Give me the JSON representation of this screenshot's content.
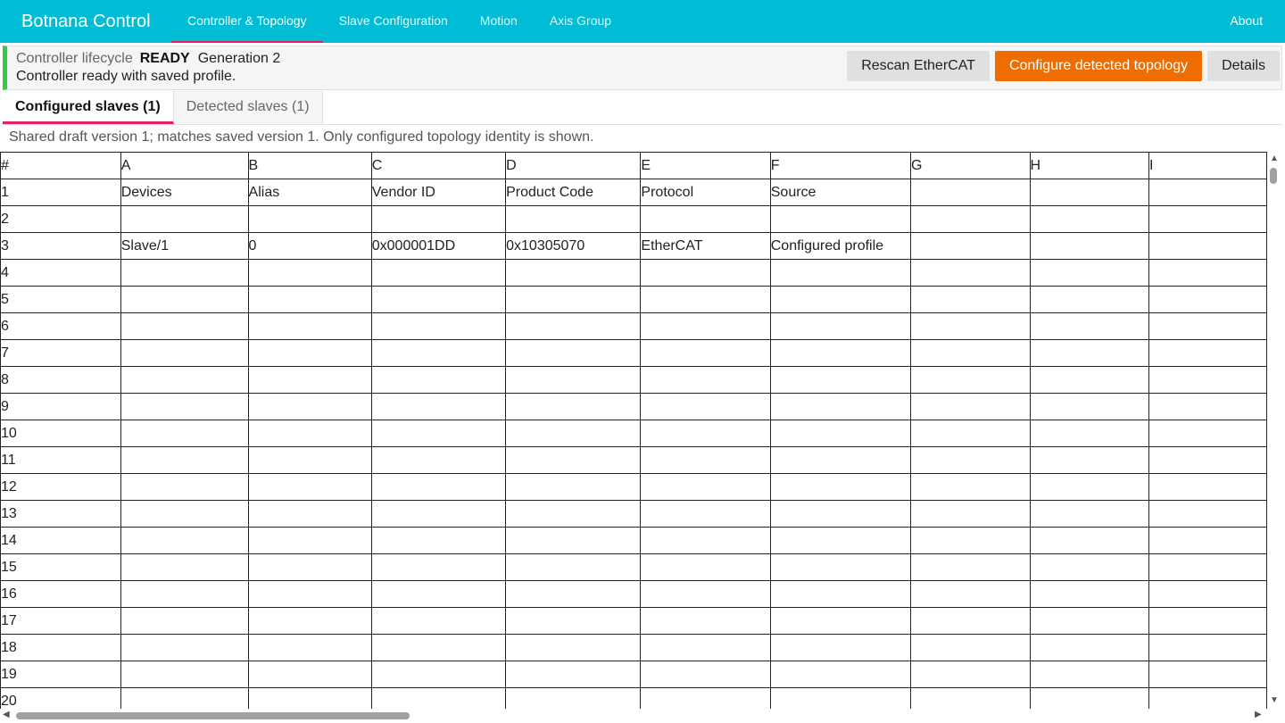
{
  "app": {
    "title": "Botnana Control"
  },
  "nav": {
    "tabs": [
      {
        "label": "Controller & Topology",
        "active": true
      },
      {
        "label": "Slave Configuration",
        "active": false
      },
      {
        "label": "Motion",
        "active": false
      },
      {
        "label": "Axis Group",
        "active": false
      }
    ],
    "about_label": "About"
  },
  "lifecycle": {
    "label": "Controller lifecycle",
    "state": "READY",
    "generation": "Generation 2",
    "message": "Controller ready with saved profile.",
    "status_color": "#2ecc40",
    "actions": {
      "rescan_label": "Rescan EtherCAT",
      "configure_label": "Configure detected topology",
      "details_label": "Details"
    }
  },
  "subtabs": [
    {
      "label": "Configured slaves (1)",
      "active": true
    },
    {
      "label": "Detected slaves (1)",
      "active": false
    }
  ],
  "draft_note": "Shared draft version 1; matches saved version 1. Only configured topology identity is shown.",
  "sheet": {
    "corner": "#",
    "columns": [
      "A",
      "B",
      "C",
      "D",
      "E",
      "F",
      "G",
      "H",
      "I"
    ],
    "rows": [
      {
        "num": "1",
        "cells": [
          "Devices",
          "Alias",
          "Vendor ID",
          "Product Code",
          "Protocol",
          "Source",
          "",
          "",
          ""
        ]
      },
      {
        "num": "2",
        "cells": [
          "",
          "",
          "",
          "",
          "",
          "",
          "",
          "",
          ""
        ]
      },
      {
        "num": "3",
        "cells": [
          "Slave/1",
          "0",
          "0x000001DD",
          "0x10305070",
          "EtherCAT",
          "Configured profile",
          "",
          "",
          ""
        ]
      },
      {
        "num": "4",
        "cells": [
          "",
          "",
          "",
          "",
          "",
          "",
          "",
          "",
          ""
        ]
      },
      {
        "num": "5",
        "cells": [
          "",
          "",
          "",
          "",
          "",
          "",
          "",
          "",
          ""
        ]
      },
      {
        "num": "6",
        "cells": [
          "",
          "",
          "",
          "",
          "",
          "",
          "",
          "",
          ""
        ]
      },
      {
        "num": "7",
        "cells": [
          "",
          "",
          "",
          "",
          "",
          "",
          "",
          "",
          ""
        ]
      },
      {
        "num": "8",
        "cells": [
          "",
          "",
          "",
          "",
          "",
          "",
          "",
          "",
          ""
        ]
      },
      {
        "num": "9",
        "cells": [
          "",
          "",
          "",
          "",
          "",
          "",
          "",
          "",
          ""
        ]
      },
      {
        "num": "10",
        "cells": [
          "",
          "",
          "",
          "",
          "",
          "",
          "",
          "",
          ""
        ]
      },
      {
        "num": "11",
        "cells": [
          "",
          "",
          "",
          "",
          "",
          "",
          "",
          "",
          ""
        ]
      },
      {
        "num": "12",
        "cells": [
          "",
          "",
          "",
          "",
          "",
          "",
          "",
          "",
          ""
        ]
      },
      {
        "num": "13",
        "cells": [
          "",
          "",
          "",
          "",
          "",
          "",
          "",
          "",
          ""
        ]
      },
      {
        "num": "14",
        "cells": [
          "",
          "",
          "",
          "",
          "",
          "",
          "",
          "",
          ""
        ]
      },
      {
        "num": "15",
        "cells": [
          "",
          "",
          "",
          "",
          "",
          "",
          "",
          "",
          ""
        ]
      },
      {
        "num": "16",
        "cells": [
          "",
          "",
          "",
          "",
          "",
          "",
          "",
          "",
          ""
        ]
      },
      {
        "num": "17",
        "cells": [
          "",
          "",
          "",
          "",
          "",
          "",
          "",
          "",
          ""
        ]
      },
      {
        "num": "18",
        "cells": [
          "",
          "",
          "",
          "",
          "",
          "",
          "",
          "",
          ""
        ]
      },
      {
        "num": "19",
        "cells": [
          "",
          "",
          "",
          "",
          "",
          "",
          "",
          "",
          ""
        ]
      },
      {
        "num": "20",
        "cells": [
          "",
          "",
          "",
          "",
          "",
          "",
          "",
          "",
          ""
        ]
      }
    ]
  },
  "colors": {
    "navbar": "#00bcd4",
    "accent": "#e91e63",
    "primary_button": "#ef6c00",
    "ready": "#2ecc40"
  }
}
